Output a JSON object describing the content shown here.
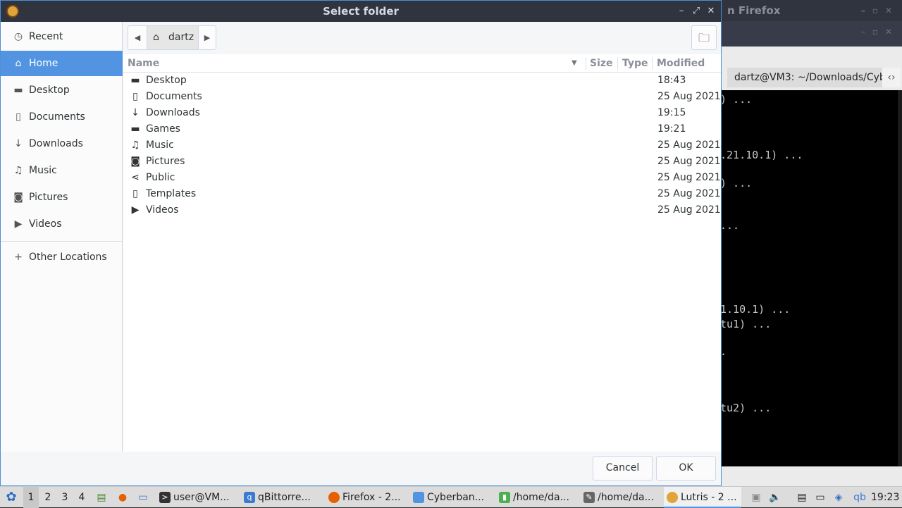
{
  "background": {
    "window_title": "n Firefox",
    "tab_label": "dartz@VM3: ~/Downloads/Cyb",
    "terminal_lines": [
      ") ...",
      ".21.10.1) ...",
      ") ...",
      "...",
      "1.10.1) ...",
      "tu1) ...",
      ".",
      "tu2) ..."
    ]
  },
  "dialog": {
    "title": "Select folder",
    "sidebar": {
      "items": [
        {
          "label": "Recent",
          "icon": "clock-icon"
        },
        {
          "label": "Home",
          "icon": "home-icon"
        },
        {
          "label": "Desktop",
          "icon": "folder-icon"
        },
        {
          "label": "Documents",
          "icon": "document-icon"
        },
        {
          "label": "Downloads",
          "icon": "download-icon"
        },
        {
          "label": "Music",
          "icon": "music-icon"
        },
        {
          "label": "Pictures",
          "icon": "camera-icon"
        },
        {
          "label": "Videos",
          "icon": "video-icon"
        }
      ],
      "other_locations": "Other Locations"
    },
    "path": {
      "crumb": "dartz"
    },
    "columns": {
      "name": "Name",
      "size": "Size",
      "type": "Type",
      "modified": "Modified"
    },
    "files": [
      {
        "name": "Desktop",
        "modified": "18:43",
        "icon": "folder-icon"
      },
      {
        "name": "Documents",
        "modified": "25 Aug 2021",
        "icon": "document-icon"
      },
      {
        "name": "Downloads",
        "modified": "19:15",
        "icon": "download-icon"
      },
      {
        "name": "Games",
        "modified": "19:21",
        "icon": "folder-icon"
      },
      {
        "name": "Music",
        "modified": "25 Aug 2021",
        "icon": "music-icon"
      },
      {
        "name": "Pictures",
        "modified": "25 Aug 2021",
        "icon": "camera-icon"
      },
      {
        "name": "Public",
        "modified": "25 Aug 2021",
        "icon": "share-icon"
      },
      {
        "name": "Templates",
        "modified": "25 Aug 2021",
        "icon": "template-icon"
      },
      {
        "name": "Videos",
        "modified": "25 Aug 2021",
        "icon": "video-icon"
      }
    ],
    "buttons": {
      "cancel": "Cancel",
      "ok": "OK"
    }
  },
  "taskbar": {
    "workspaces": [
      "1",
      "2",
      "3",
      "4"
    ],
    "tasks": [
      {
        "label": "user@VM..."
      },
      {
        "label": "qBittorre..."
      },
      {
        "label": "Firefox - 2..."
      },
      {
        "label": "Cyberban..."
      },
      {
        "label": "/home/da..."
      },
      {
        "label": "/home/da..."
      },
      {
        "label": "Lutris - 2 ..."
      }
    ],
    "tray_qb": "qb",
    "clock": "19:23"
  }
}
